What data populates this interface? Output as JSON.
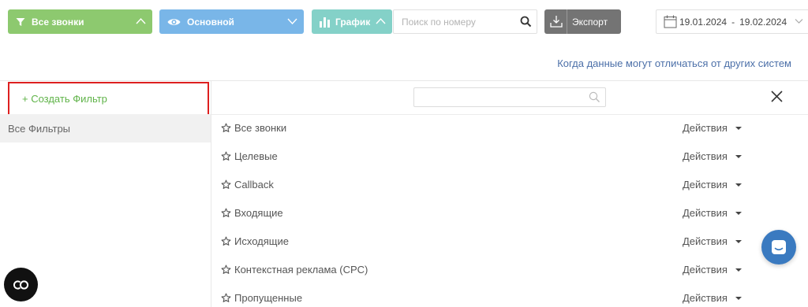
{
  "toolbar": {
    "calls_label": "Все звонки",
    "view_label": "Основной",
    "graph_label": "График",
    "search_placeholder": "Поиск по номеру",
    "export_label": "Экспорт",
    "date_from": "19.01.2024",
    "date_sep": "-",
    "date_to": "19.02.2024"
  },
  "info_link": "Когда данные могут отличаться от других систем",
  "sidebar": {
    "create_filter": "+ Создать Фильтр",
    "all_filters": "Все Фильтры"
  },
  "filters": {
    "search_placeholder": "",
    "actions_label": "Действия",
    "items": [
      {
        "name": "Все звонки"
      },
      {
        "name": "Целевые"
      },
      {
        "name": "Callback"
      },
      {
        "name": "Входящие"
      },
      {
        "name": "Исходящие"
      },
      {
        "name": "Контекстная реклама (CPC)"
      },
      {
        "name": "Пропущенные"
      }
    ]
  },
  "colors": {
    "calls_button": "#8dc96f",
    "view_button": "#79b6e8",
    "graph_button": "#84d1c8",
    "export_button": "#747474",
    "create_filter_text": "#5fb348",
    "highlight_border": "#dd1f1f",
    "link": "#4b6fa8",
    "chat_bubble": "#3a7ac0"
  },
  "icons": {
    "calls": "filter-icon",
    "view": "eye-icon",
    "graph": "bar-chart-icon",
    "search": "search-icon",
    "export": "download-icon",
    "date": "calendar-icon",
    "close": "close-icon",
    "star": "star-outline-icon",
    "chat": "chat-icon",
    "badge": "co-logo-icon"
  }
}
